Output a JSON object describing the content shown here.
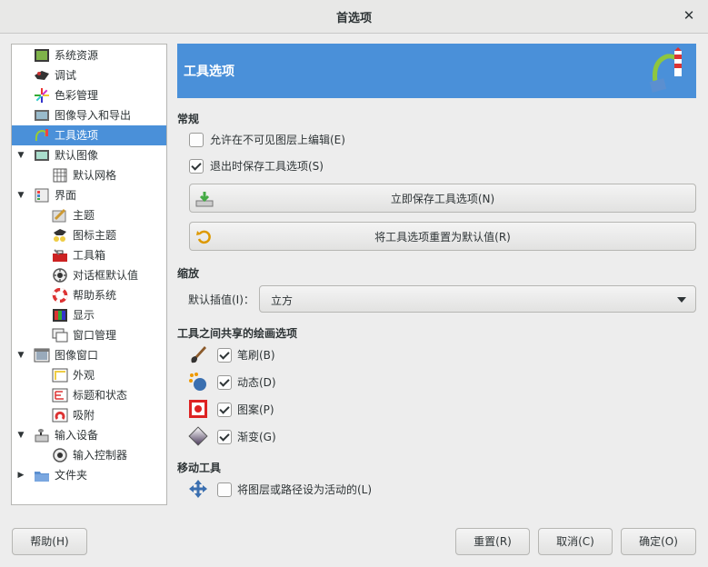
{
  "window": {
    "title": "首选项",
    "close_label": "✕"
  },
  "tree": [
    {
      "label": "系统资源",
      "selected": false
    },
    {
      "label": "调试",
      "selected": false
    },
    {
      "label": "色彩管理",
      "selected": false
    },
    {
      "label": "图像导入和导出",
      "selected": false
    },
    {
      "label": "工具选项",
      "selected": true
    },
    {
      "label": "默认图像",
      "expanded": true
    },
    {
      "label": "默认网格"
    },
    {
      "label": "界面",
      "expanded": true
    },
    {
      "label": "主题"
    },
    {
      "label": "图标主题"
    },
    {
      "label": "工具箱"
    },
    {
      "label": "对话框默认值"
    },
    {
      "label": "帮助系统"
    },
    {
      "label": "显示"
    },
    {
      "label": "窗口管理"
    },
    {
      "label": "图像窗口",
      "expanded": true
    },
    {
      "label": "外观"
    },
    {
      "label": "标题和状态"
    },
    {
      "label": "吸附"
    },
    {
      "label": "输入设备",
      "expanded": true
    },
    {
      "label": "输入控制器"
    },
    {
      "label": "文件夹",
      "expanded": false
    }
  ],
  "header": {
    "title": "工具选项"
  },
  "general": {
    "title": "常规",
    "edit_invisible": {
      "label": "允许在不可见图层上编辑(E)",
      "checked": false
    },
    "save_on_exit": {
      "label": "退出时保存工具选项(S)",
      "checked": true
    },
    "save_now_button": "立即保存工具选项(N)",
    "reset_button": "将工具选项重置为默认值(R)"
  },
  "scaling": {
    "title": "缩放",
    "interp_label": "默认插值(I)：",
    "interp_value": "立方"
  },
  "paint_shared": {
    "title": "工具之间共享的绘画选项",
    "brush": {
      "label": "笔刷(B)",
      "checked": true
    },
    "dynamics": {
      "label": "动态(D)",
      "checked": true
    },
    "pattern": {
      "label": "图案(P)",
      "checked": true
    },
    "gradient": {
      "label": "渐变(G)",
      "checked": true
    }
  },
  "move_tool": {
    "title": "移动工具",
    "set_active": {
      "label": "将图层或路径设为活动的(L)",
      "checked": false
    }
  },
  "footer": {
    "help": "帮助(H)",
    "reset": "重置(R)",
    "cancel": "取消(C)",
    "ok": "确定(O)"
  },
  "colors": {
    "accent": "#4a90d9",
    "window_bg": "#ededed"
  }
}
